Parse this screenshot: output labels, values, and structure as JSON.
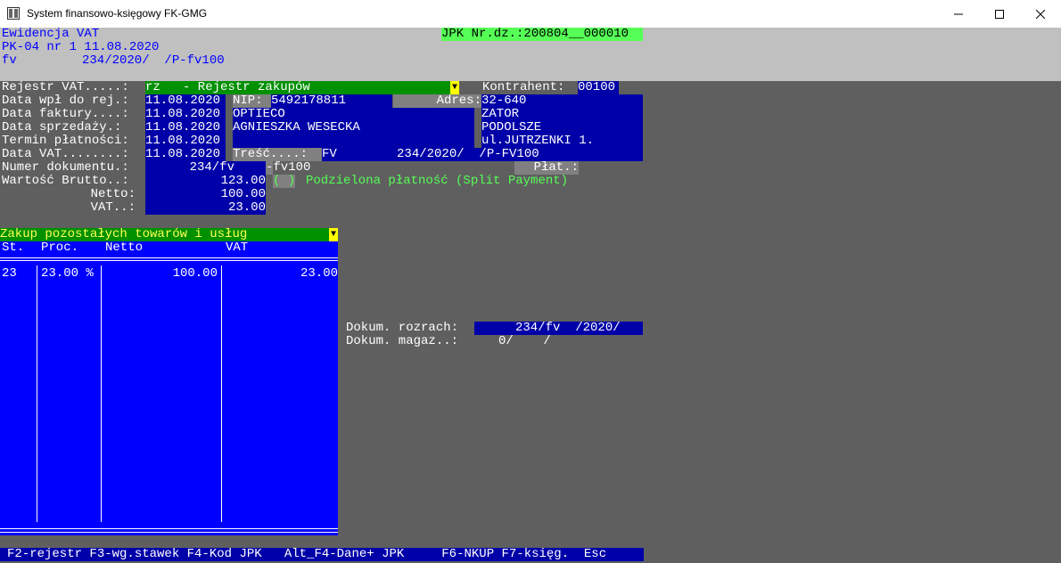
{
  "window": {
    "title": "System finansowo-księgowy FK-GMG"
  },
  "header": {
    "line1": "Ewidencja VAT",
    "line2": "PK-04 nr 1 11.08.2020",
    "line3_a": "fv",
    "line3_b": "234/2020/  /P-fv100",
    "jpk": "JPK Nr.dz.:200804__000010"
  },
  "form": {
    "rejestr_label": "Rejestr VAT.....:",
    "rejestr_value": "rz   - Rejestr zakupów",
    "kontrahent_label": "Kontrahent:",
    "kontrahent_value": "00100",
    "data_wpl_label": "Data wpł do rej.:",
    "data_wpl_value": "11.08.2020",
    "nip_label": "NIP:",
    "nip_value": "5492178811",
    "adres_label": "Adres:",
    "adres_value": "32-640",
    "data_faktury_label": "Data faktury....:",
    "data_faktury_value": "11.08.2020",
    "name1": "OPTIECO",
    "city": "ZATOR",
    "data_sprzedazy_label": "Data sprzedaży.:",
    "data_sprzedazy_value": "11.08.2020",
    "name2": "AGNIESZKA WESECKA",
    "region": "PODOLSZE",
    "termin_label": "Termin płatności:",
    "termin_value": "11.08.2020",
    "street": "ul.JUTRZENKI 1.",
    "data_vat_label": "Data VAT........:",
    "data_vat_value": "11.08.2020",
    "tresc_label": "Treść....:",
    "tresc_value": "FV        234/2020/  /P-FV100",
    "numer_label": "Numer dokumentu.:",
    "numer_value": "234/fv",
    "numer_suffix": "-fv100",
    "plat_label": "Płat.:",
    "brutto_label": "Wartość Brutto..:",
    "brutto_value": "123.00",
    "split_checkbox": "( )",
    "split_label": "Podzielona płatność (Split Payment)",
    "netto_label": "Netto:",
    "netto_value": "100.00",
    "vat_label": "VAT..:",
    "vat_value": "23.00"
  },
  "table": {
    "title": "Zakup pozostałych towarów i usług",
    "headers": {
      "st": "St.",
      "proc": "Proc.",
      "netto": "Netto",
      "vat": "VAT"
    },
    "rows": [
      {
        "st": "23",
        "proc": "23.00 %",
        "netto": "100.00",
        "vat": "23.00"
      }
    ]
  },
  "dokum": {
    "rozrach_label": "Dokum. rozrach:",
    "rozrach_value": "234/fv  /2020/",
    "magaz_label": "Dokum. magaz..:",
    "magaz_value": "0/    /"
  },
  "footer": {
    "keys": "F2-rejestr F3-wg.stawek F4-Kod JPK   Alt_F4-Dane+ JPK     F6-NKUP F7-księg.  Esc"
  },
  "colors": {
    "background": "#5f5f5f",
    "field_blue": "#0000a8",
    "field_green": "#009000",
    "header_grey": "#c0c0c0"
  }
}
